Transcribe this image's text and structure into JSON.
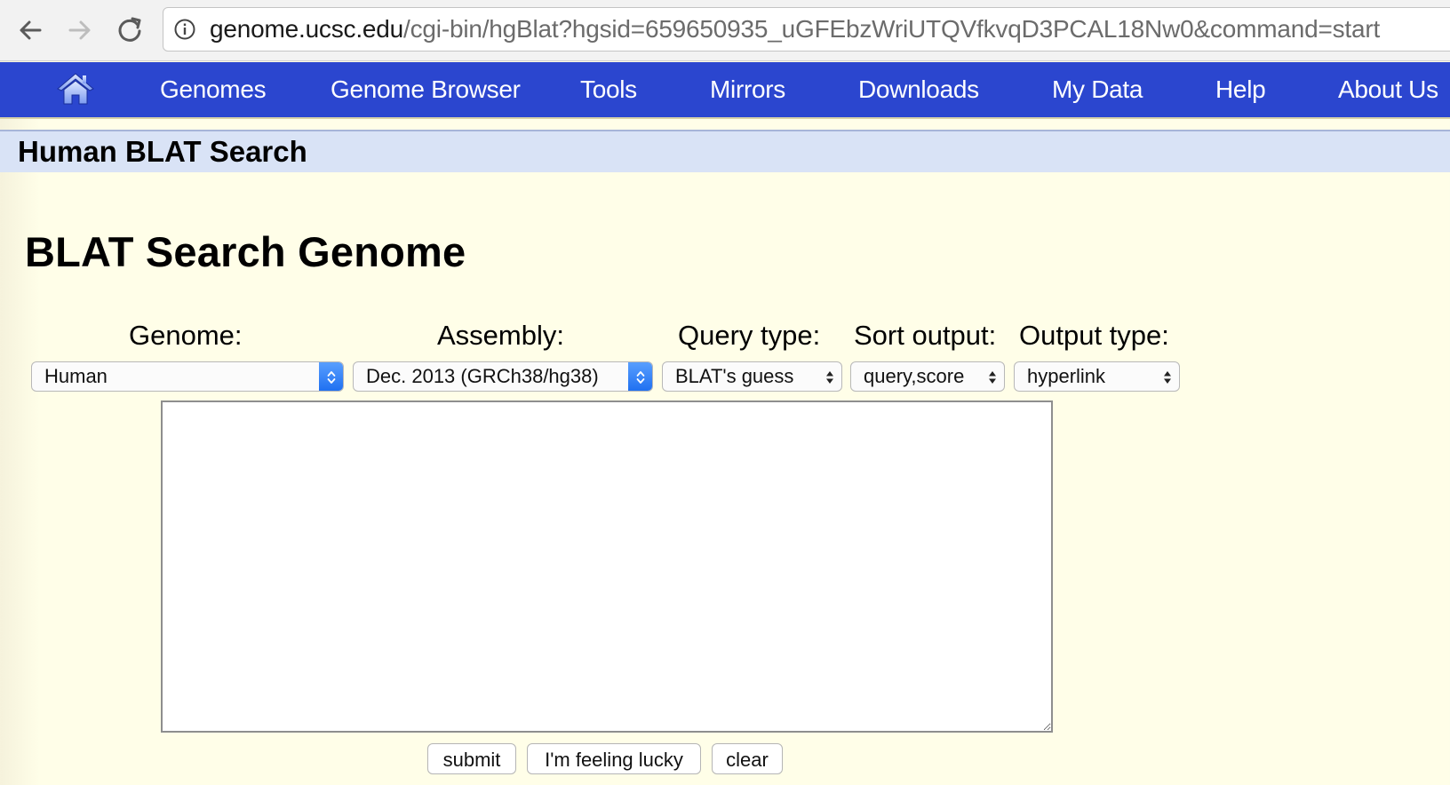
{
  "browser": {
    "url_host": "genome.ucsc.edu",
    "url_path": "/cgi-bin/hgBlat?hgsid=659650935_uGFEbzWriUTQVfkvqD3PCAL18Nw0&command=start"
  },
  "nav": {
    "items": [
      "Genomes",
      "Genome Browser",
      "Tools",
      "Mirrors",
      "Downloads",
      "My Data",
      "Help",
      "About Us"
    ]
  },
  "page": {
    "title": "Human BLAT Search",
    "heading": "BLAT Search Genome"
  },
  "form": {
    "labels": {
      "genome": "Genome:",
      "assembly": "Assembly:",
      "query_type": "Query type:",
      "sort_output": "Sort output:",
      "output_type": "Output type:"
    },
    "values": {
      "genome": "Human",
      "assembly": "Dec. 2013 (GRCh38/hg38)",
      "query_type": "BLAT's guess",
      "sort_output": "query,score",
      "output_type": "hyperlink"
    },
    "sequence_text": "",
    "buttons": {
      "submit": "submit",
      "lucky": "I'm feeling lucky",
      "clear": "clear"
    }
  },
  "colors": {
    "nav_background": "#2b46cf",
    "title_bar": "#d9e3f6",
    "page_background": "#fffee8"
  }
}
